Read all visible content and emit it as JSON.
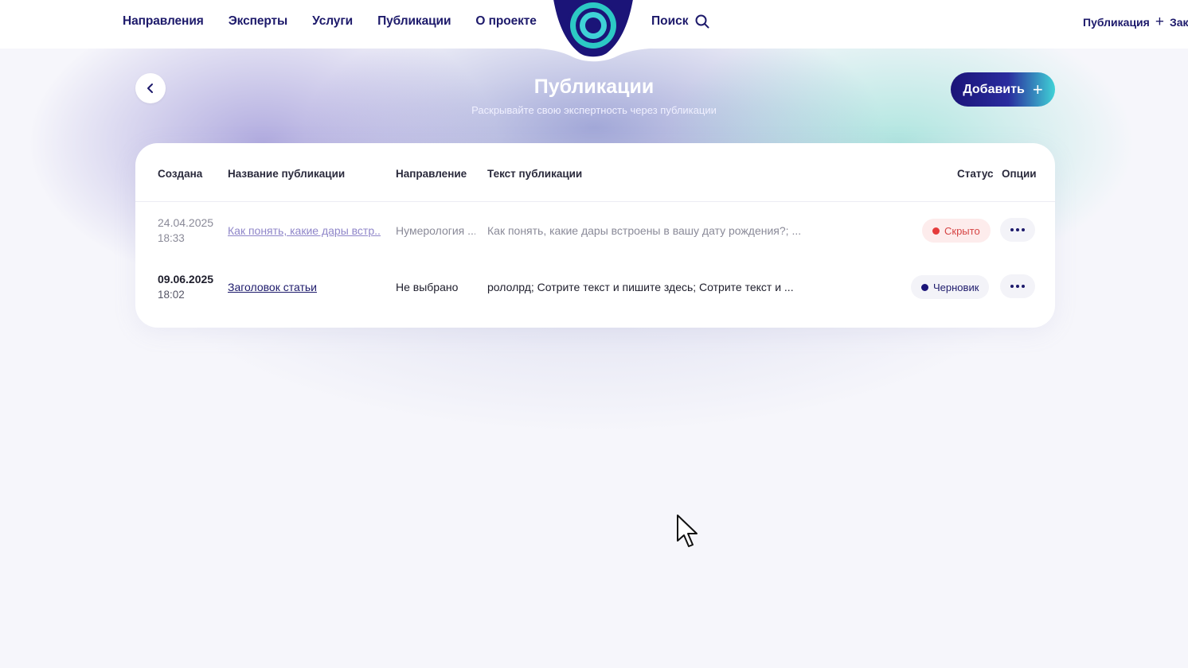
{
  "nav": {
    "items": [
      "Направления",
      "Эксперты",
      "Услуги",
      "Публикации",
      "О проекте"
    ],
    "search_label": "Поиск",
    "search_icon": "search-icon",
    "publication_label": "Публикация",
    "publication_plus": "+",
    "cut_label": "Зак"
  },
  "logo": {
    "icon": "concentric-circles-logo",
    "colors": [
      "#1b1478",
      "#3fd2d6"
    ]
  },
  "page": {
    "title": "Публикации",
    "subtitle": "Раскрывайте свою экспертность через публикации",
    "back_icon": "chevron-left-icon",
    "add_label": "Добавить",
    "add_plus": "+"
  },
  "table": {
    "columns": [
      "Создана",
      "Название публикации",
      "Направление",
      "Текст публикации",
      "Статус",
      "Опции"
    ],
    "rows": [
      {
        "date": "24.04.2025",
        "time": "18:33",
        "title": "Как понять, какие дары встр...",
        "direction": "Нумерология ...",
        "text": "Как понять, какие дары встроены в вашу дату рождения?; ...",
        "status": "Скрыто",
        "status_color": "#e53b3b"
      },
      {
        "date": "09.06.2025",
        "time": "18:02",
        "title": "Заголовок статьи",
        "direction": "Не выбрано",
        "text": "рололрд; Сотрите текст и пишите здесь; Сотрите текст и ...",
        "status": "Черновик",
        "status_color": "#1b1478"
      }
    ],
    "options_icon": "more-horizontal-icon"
  },
  "colors": {
    "brand": "#1d1a6b",
    "accent": "#3fd2d6"
  }
}
